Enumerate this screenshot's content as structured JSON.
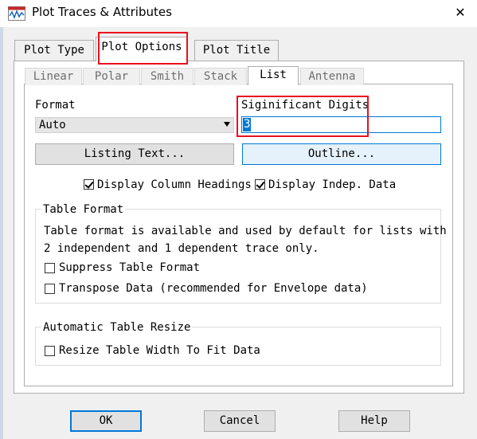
{
  "window": {
    "title": "Plot Traces & Attributes",
    "close_glyph": "✕",
    "icon": "waveform-icon"
  },
  "main_tabs": [
    {
      "label": "Plot Type"
    },
    {
      "label": "Plot Options",
      "active": true
    },
    {
      "label": "Plot Title"
    }
  ],
  "sub_tabs": [
    {
      "label": "Linear"
    },
    {
      "label": "Polar"
    },
    {
      "label": "Smith"
    },
    {
      "label": "Stack"
    },
    {
      "label": "List",
      "active": true
    },
    {
      "label": "Antenna"
    }
  ],
  "format": {
    "label": "Format",
    "value": "Auto"
  },
  "digits": {
    "label": "Siginificant Digits",
    "value": "3"
  },
  "buttons": {
    "listing": "Listing Text...",
    "outline": "Outline..."
  },
  "checks": {
    "col_headings": {
      "label": "Display Column Headings",
      "checked": true
    },
    "indep_data": {
      "label": "Display Indep. Data",
      "checked": true
    }
  },
  "table_format": {
    "title": "Table Format",
    "desc1": "Table format is available and used by default for lists with",
    "desc2": "2 independent and 1 dependent trace only.",
    "suppress": {
      "label": "Suppress Table Format",
      "checked": false
    },
    "transpose": {
      "label": "Transpose Data (recommended for Envelope data)",
      "checked": false
    }
  },
  "auto_resize": {
    "title": "Automatic Table Resize",
    "resize": {
      "label": "Resize Table Width To Fit Data",
      "checked": false
    }
  },
  "footer": {
    "ok": "OK",
    "cancel": "Cancel",
    "help": "Help"
  },
  "colors": {
    "highlight": "#e8101e",
    "accent": "#0078d7"
  }
}
